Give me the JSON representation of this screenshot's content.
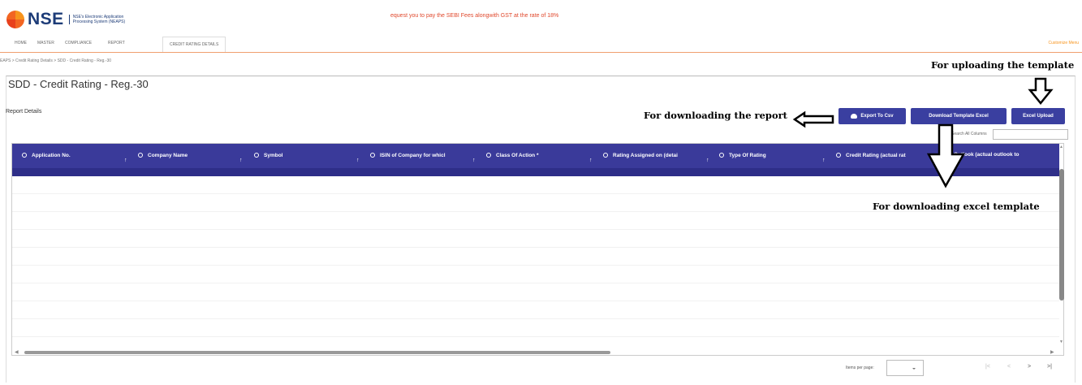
{
  "header": {
    "logo_text": "NSE",
    "logo_subtitle": "NSE's Electronic Application Processing System (NEAPS)",
    "banner_text": "equest you to pay the SEBI Fees alongwith GST at the rate of 18%"
  },
  "menu": {
    "items": [
      "HOME",
      "MASTER",
      "COMPLIANCE",
      "REPORT",
      "CREDIT RATING DETAILS"
    ],
    "customize_label": "Customize Menu"
  },
  "breadcrumb": "EAPS > Credit Rating Details > SDD - Credit Rating - Reg.-30",
  "page": {
    "title": "SDD - Credit Rating - Reg.-30",
    "report_details_label": "Report Details"
  },
  "toolbar": {
    "export_label": "Export To Csv",
    "download_template_label": "Download Template Excel",
    "upload_label": "Excel Upload"
  },
  "search": {
    "label": "Search All Columns",
    "value": ""
  },
  "table": {
    "columns": [
      "Application No.",
      "Company Name",
      "Symbol",
      "ISIN of Company for whicl",
      "Class Of Action *",
      "Rating Assigned on (detai",
      "Type Of Rating",
      "Credit Rating (actual rat",
      "Outlook (actual outlook to"
    ],
    "sort_glyph": "↑",
    "rows": []
  },
  "pagination": {
    "items_per_page_label": "Items per page:",
    "items_per_page_value": "",
    "first_glyph": "|<",
    "prev_glyph": "<",
    "next_glyph": ">",
    "last_glyph": ">|"
  },
  "annotations": {
    "upload_note": "For uploading the template",
    "report_note": "For downloading the report",
    "excel_note": "For downloading excel template"
  },
  "colors": {
    "primary": "#3a3fa0",
    "header_bg": "#3a3a9a",
    "brand_orange": "#f26522",
    "banner_red": "#e0482c",
    "brand_navy": "#1d3c78"
  }
}
